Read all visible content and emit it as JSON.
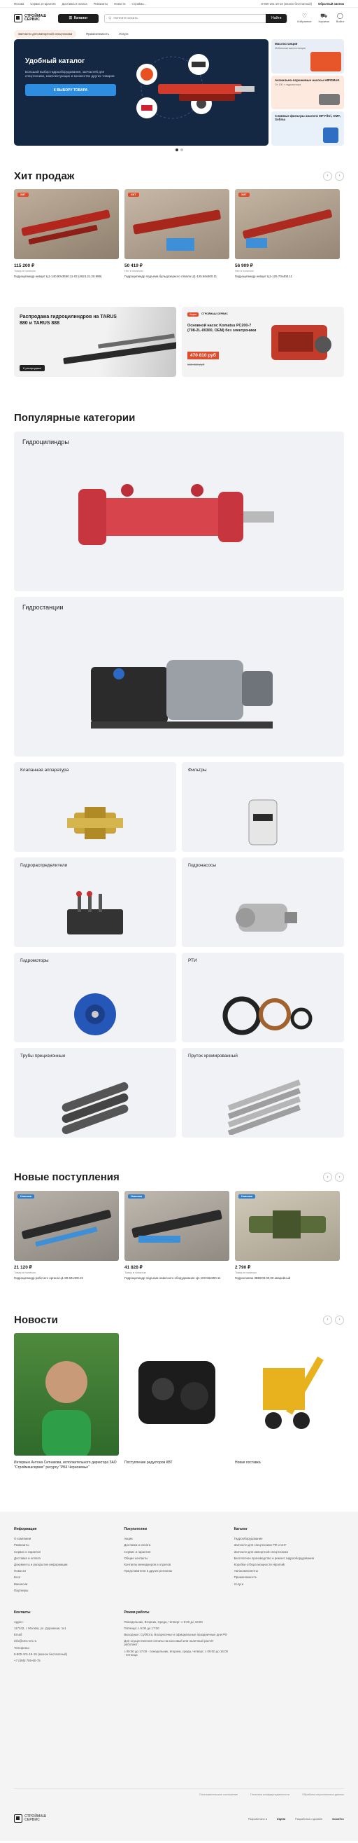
{
  "topbar": {
    "city": "Москва",
    "links": [
      "Сервис и гарантия",
      "Доставка и оплата",
      "Реквизиты",
      "Новости",
      "Стройма..."
    ],
    "phone": "8-800-101-19-19 (звонок бесплатный)",
    "callback": "Обратный звонок"
  },
  "header": {
    "logo": "СТРОЙМАШ СЕРВИС",
    "catalog": "Каталог",
    "search_placeholder": "Начните искать",
    "search_button": "Найти",
    "icons": [
      {
        "name": "Избранное",
        "icon": "heart-icon"
      },
      {
        "name": "Корзина",
        "icon": "cart-icon"
      },
      {
        "name": "Войти",
        "icon": "user-icon"
      }
    ]
  },
  "subnav": {
    "pill": "Запчасти для импортной спецтехники",
    "links": [
      "Применяемость",
      "Услуги"
    ]
  },
  "hero": {
    "title": "Удобный каталог",
    "text": "Большой выбор гидрооборудования, запчастей для спецтехники, комплектующих и множество других товаров",
    "button": "К ВЫБОРУ ТОВАРА",
    "side": [
      {
        "title": "Маслостанция",
        "note": "Мобильная маслостанция"
      },
      {
        "title": "Аксиально-поршневые насосы HIPOMAK",
        "note": "От 100 т. гидромотора"
      },
      {
        "title": "Сливные фильтры аналоги MP Filtri, OMT, Sofima",
        "note": ""
      }
    ]
  },
  "hits": {
    "title": "Хит продаж",
    "items": [
      {
        "badge": "ХИТ",
        "price": "115 200 ₽",
        "avail": "Товар в наличии",
        "name": "Гидроцилиндр невцит Ц1-140.90х3550.11-02 (4624.21.20.999)"
      },
      {
        "badge": "ХИТ",
        "price": "50 419 ₽",
        "avail": "Нет в наличии",
        "name": "Гидроцилиндр подъема бульдозерного отвала Ц1-125.56х600.11"
      },
      {
        "badge": "ХИТ",
        "price": "56 909 ₽",
        "avail": "Нет в наличии",
        "name": "Гидроцилиндр невцит Ц1-125.70х400.11"
      }
    ]
  },
  "banners": {
    "left": "Распродажа гидроцилиндров на TARUS 880 и TARUS 888",
    "right_title": "Основной насос Komatsu PC200-7 (708-2L-00300, OEM) без электроники",
    "right_price": "470 810 руб",
    "right_old": "560 000 руб",
    "right_tag": "Акция",
    "right_brand": "СТРОЙМАШ СЕРВИС",
    "left_button": "К распродаже"
  },
  "popular": {
    "title": "Популярные категории",
    "big": [
      "Гидроцилиндры",
      "Гидростанции"
    ],
    "small": [
      "Клапанная аппаратура",
      "Фильтры",
      "Гидрораспределители",
      "Гидронасосы",
      "Гидромоторы",
      "РТИ",
      "Трубы прецизионные",
      "Пруток хромированный"
    ]
  },
  "arrivals": {
    "title": "Новые поступления",
    "items": [
      {
        "badge": "Новинка",
        "price": "21 120 ₽",
        "avail": "Товар в наличии",
        "name": "Гидроцилиндр рабочего органа Ц1-80.50х400.22"
      },
      {
        "badge": "Новинка",
        "price": "41 828 ₽",
        "avail": "Товар в наличии",
        "name": "Гидроцилиндр подъема навесного оборудования Ц1-100.56х800.11"
      },
      {
        "badge": "Новинка",
        "price": "2 790 ₽",
        "avail": "Товар в наличии",
        "name": "Гидроклапан 3ВКЕ03.00.00 аварийный"
      }
    ]
  },
  "news": {
    "title": "Новости",
    "items": [
      "Интервью Антона Ситникова, исполнительного директора ЗАО \"Строймашсервис\" ресурсу \"РБК Черноземье\"",
      "Поступление редукторов КВТ",
      "Новая поставка"
    ]
  },
  "footer": {
    "columns": [
      {
        "title": "Информация",
        "items": [
          "О компании",
          "Реквизиты",
          "Сервис и гарантия",
          "Доставка и оплата",
          "Документы и раскрытие информации",
          "Новости",
          "Блог",
          "Вакансии",
          "Партнеры"
        ]
      },
      {
        "title": "Покупателям",
        "items": [
          "Акции",
          "Доставка и оплата",
          "Сервис и гарантия",
          "Общие контакты",
          "Контакты менеджеров и отделов",
          "Представители в других регионах"
        ]
      },
      {
        "title": "Каталог",
        "items": [
          "Гидрооборудование",
          "Запчасти для спецтехники РФ и СНГ",
          "Запчасти для импортной спецтехники",
          "Бесплатное производство и ремонт гидрооборудования",
          "Коробки отбора мощности Hipomak",
          "Автокомпоненты",
          "Применяемость",
          "Услуги"
        ]
      }
    ],
    "contacts_title": "Контакты",
    "contacts": [
      "Адрес:",
      "117342, г. Москва, ул. Дорожная, 1к1",
      "Email:",
      "info@sms-vrn.ru",
      "Телефоны:",
      "8-800-101-19-19 (звонок бесплатный)",
      "+7 (495) 785-60-75"
    ],
    "hours_title": "Режим работы",
    "hours": [
      "Понедельник, Вторник, Среда, Четверг: с 9:00 до 18:00",
      "Пятница: с 9:00 до 17:00",
      "Выходные: Суббота, Воскресенье и официальные праздничные дни РФ",
      "Для осуществления оплаты на кассовый или наличный расчёт работают:",
      "с 09:00 до 17:00 - понедельник, вторник, среда, четверг; с 09:00 до 16:00 - пятница"
    ],
    "policy": "Пользовательское соглашение",
    "privacy": "Политика конфиденциальности",
    "personal": "Обработка персональных данных",
    "partner": "Разработано в",
    "partner_name": "Digital",
    "design": "Разработка и дизайн",
    "design_name": "GoodTec"
  }
}
